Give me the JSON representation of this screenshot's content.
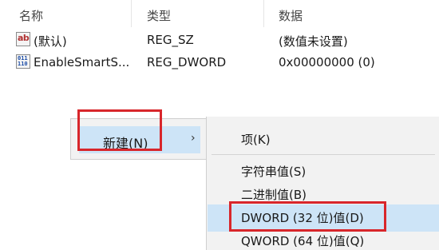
{
  "columns": {
    "name": "名称",
    "type": "类型",
    "data": "数据"
  },
  "values": [
    {
      "icon": "string-value-icon",
      "icon_text": "ab",
      "name": "(默认)",
      "type": "REG_SZ",
      "data": "(数值未设置)"
    },
    {
      "icon": "binary-value-icon",
      "icon_text": "011\n110",
      "name": "EnableSmartS...",
      "type": "REG_DWORD",
      "data": "0x00000000 (0)"
    }
  ],
  "context_menu": {
    "new_label": "新建(N)",
    "submenu_arrow": "›"
  },
  "submenu": {
    "items": [
      "项(K)",
      "字符串值(S)",
      "二进制值(B)",
      "DWORD (32 位)值(D)",
      "QWORD (64 位)值(Q)"
    ],
    "highlighted": "DWORD (32 位)值(D)"
  },
  "colors": {
    "highlight_box": "#d8262b",
    "selection": "#cde4f7",
    "menu_background": "#f2f2f2"
  }
}
